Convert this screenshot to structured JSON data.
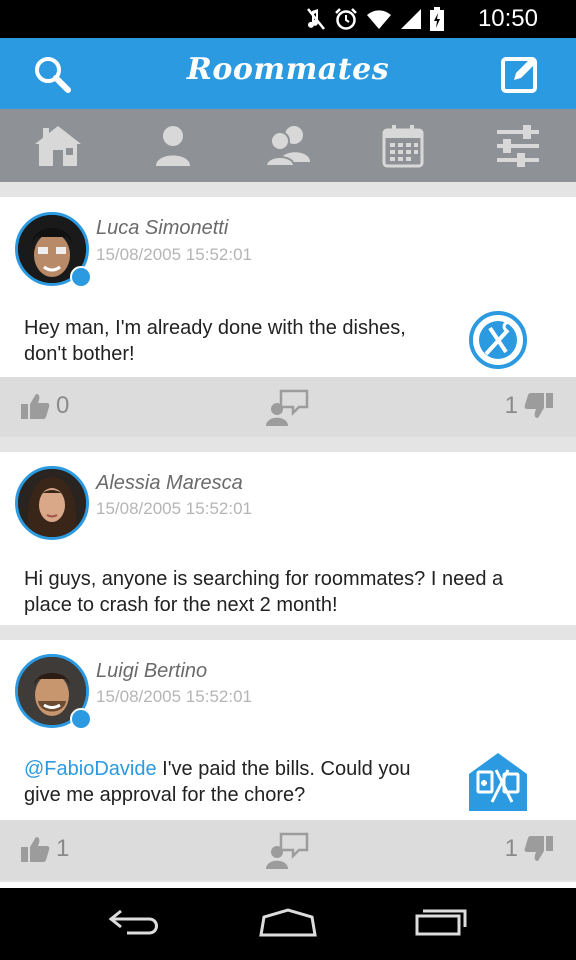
{
  "status_bar": {
    "time": "10:50"
  },
  "app_bar": {
    "title": "Roommates",
    "search_icon": "search-icon",
    "compose_icon": "compose-icon"
  },
  "tabs": [
    {
      "icon": "home-icon"
    },
    {
      "icon": "user-icon"
    },
    {
      "icon": "group-icon"
    },
    {
      "icon": "calendar-icon"
    },
    {
      "icon": "settings-sliders-icon"
    }
  ],
  "posts": [
    {
      "author": "Luca Simonetti",
      "timestamp": "15/08/2005 15:52:01",
      "text_line1": "Hey man, I'm already done with the dishes,",
      "text_line2": "don't bother!",
      "action_icon": "dishes-chore-icon",
      "likes": "0",
      "dislikes": "1"
    },
    {
      "author": "Alessia Maresca",
      "timestamp": "15/08/2005 15:52:01",
      "text_line1": "Hi guys, anyone is searching for roommates? I need a",
      "text_line2": "place to crash for the next 2 month!"
    },
    {
      "author": "Luigi Bertino",
      "timestamp": "15/08/2005 15:52:01",
      "mention": "@FabioDavide",
      "text_line1": " I've paid the bills. Could you",
      "text_line2": "give me approval for the chore?",
      "action_icon": "bills-chore-icon",
      "likes": "1",
      "dislikes": "1"
    }
  ],
  "colors": {
    "accent": "#2b9ae0",
    "tab_bar": "#8e9296",
    "action_bar": "#dcdcdc"
  }
}
